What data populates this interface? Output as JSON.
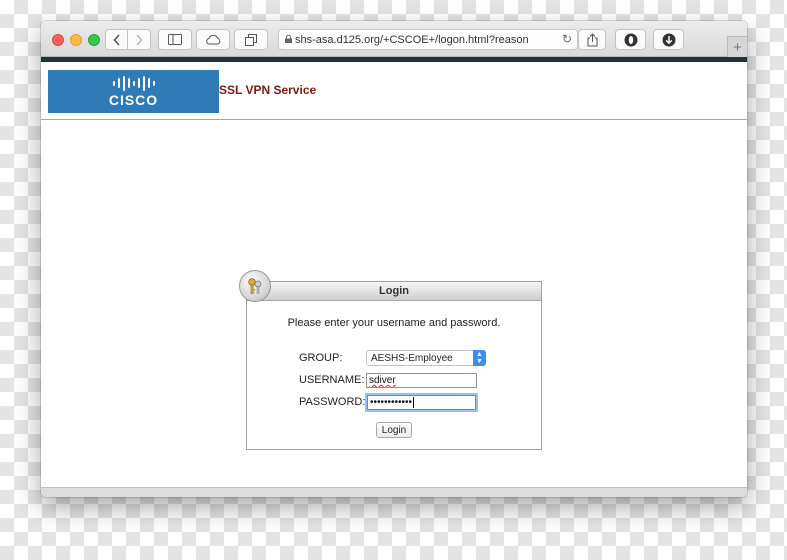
{
  "browser": {
    "url_text": "shs-asa.d125.org/+CSCOE+/logon.html?reason",
    "new_tab_label": "+",
    "icons": [
      "back-icon",
      "forward-icon",
      "sidebar-icon",
      "cloud-icon",
      "tabs-overview-icon",
      "lock-icon",
      "reload-icon",
      "share-icon",
      "privacy-icon",
      "download-icon"
    ]
  },
  "header": {
    "logo_text": "CISCO",
    "service_title": "SSL VPN Service"
  },
  "login": {
    "panel_title": "Login",
    "instructions": "Please enter your username and password.",
    "group_label": "GROUP:",
    "group_value": "AESHS-Employee",
    "username_label": "USERNAME:",
    "username_value": "sdiver",
    "password_label": "PASSWORD:",
    "password_mask": "••••••••••••",
    "button_label": "Login"
  },
  "colors": {
    "cisco_blue": "#2e7bb8",
    "title_red": "#7b1b14",
    "header_bar": "#1f3538"
  }
}
